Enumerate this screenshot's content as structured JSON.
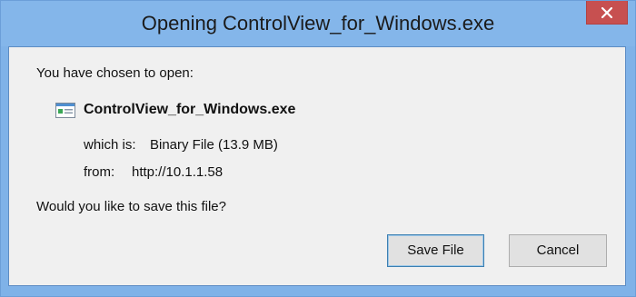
{
  "window": {
    "title": "Opening ControlView_for_Windows.exe"
  },
  "dialog": {
    "intro": "You have chosen to open:",
    "file_name": "ControlView_for_Windows.exe",
    "which_is_label": "which is:",
    "which_is_value": "Binary File (13.9 MB)",
    "from_label": "from:",
    "from_value": "http://10.1.1.58",
    "question": "Would you like to save this file?"
  },
  "buttons": {
    "save": "Save File",
    "cancel": "Cancel"
  },
  "icons": {
    "close": "close-icon",
    "file": "executable-file-icon"
  },
  "colors": {
    "title_bar": "#84b6ea",
    "close_button": "#c75050",
    "client_background": "#f0f0f0"
  }
}
